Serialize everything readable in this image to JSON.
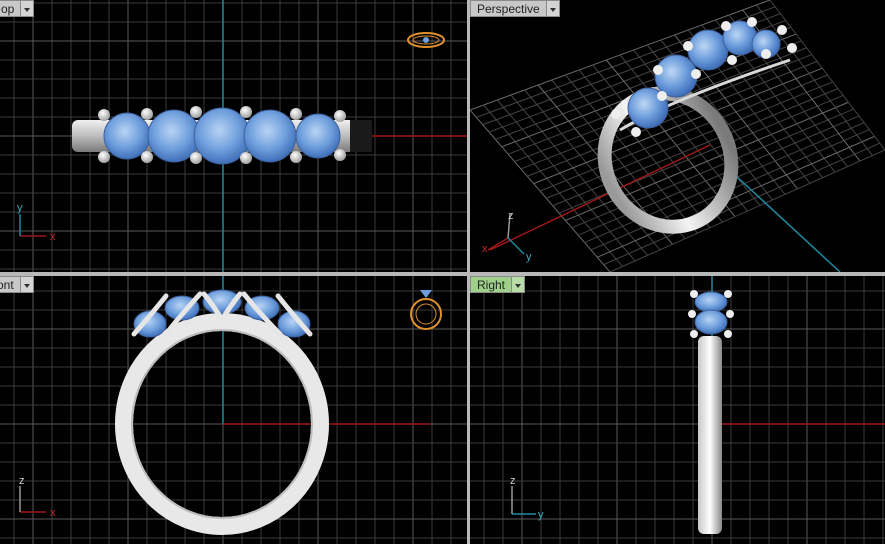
{
  "viewports": {
    "top": {
      "label": "op",
      "axis_x": "x",
      "axis_y": "y"
    },
    "perspective": {
      "label": "Perspective",
      "axis_x": "x",
      "axis_y": "y",
      "axis_z": "z"
    },
    "front": {
      "label": "ont",
      "axis_x": "x",
      "axis_z": "z"
    },
    "right": {
      "label": "Right",
      "axis_y": "y",
      "axis_z": "z"
    }
  },
  "colors": {
    "grid": "#3a3a3a",
    "grid_major": "#5a5a5a",
    "axis_x": "#a01818",
    "axis_y": "#1f8aa0",
    "gem": "#6e9edc",
    "metal": "#e6e6e6",
    "active_label": "#9fd08a",
    "nav_gizmo": "#e0902a"
  },
  "icons": [
    "ring-view-gizmo-icon",
    "dropdown-arrow-icon"
  ]
}
